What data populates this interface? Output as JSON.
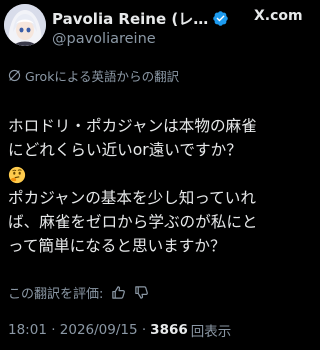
{
  "author": {
    "display_name": "Pavolia Reine (レ…",
    "handle": "@pavoliareine"
  },
  "brand": {
    "label": "X.com"
  },
  "translation": {
    "label": "Grokによる英語からの翻訳"
  },
  "post": {
    "lines": [
      "ホロドリ・ポカジャンは本物の麻雀",
      "にどれくらい近いor遠いですか？",
      "",
      "ポカジャンの基本を少し知っていれ",
      "ば、麻雀をゼロから学ぶのが私にと",
      "って簡単になると思いますか？"
    ]
  },
  "rate": {
    "label": "この翻訳を評価:"
  },
  "meta": {
    "datetime": "18:01 · 2026/09/15 ·",
    "views_count": "3866",
    "views_label": "回表示"
  },
  "colors": {
    "background": "#000000",
    "text": "#e7e9ea",
    "muted": "#8b98a5",
    "verified": "#1d9bf0"
  }
}
